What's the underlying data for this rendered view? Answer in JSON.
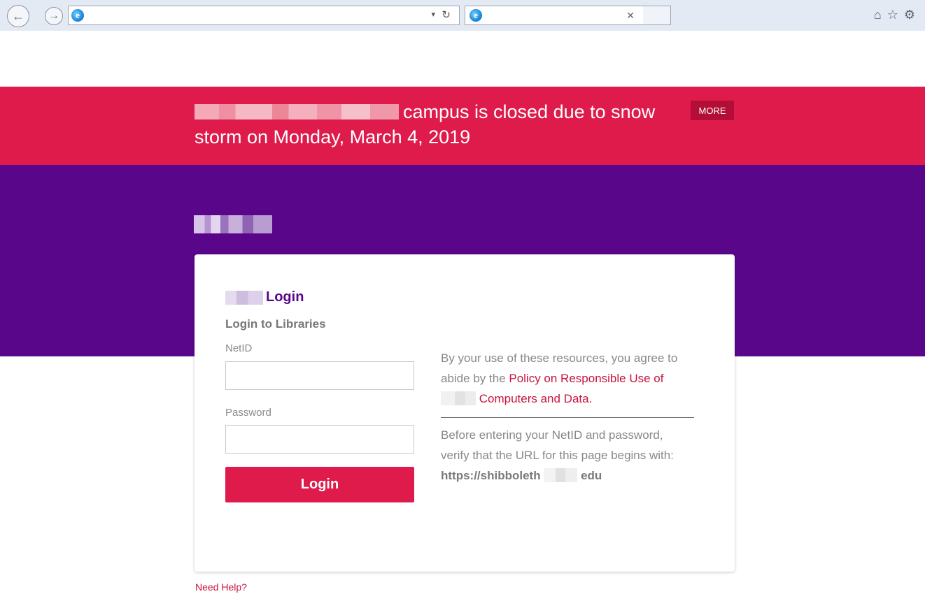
{
  "browser": {
    "address_value": "",
    "tab_title": "",
    "icons": [
      "back-icon",
      "forward-icon",
      "ie-icon",
      "dropdown-icon",
      "refresh-icon",
      "close-icon",
      "home-icon",
      "star-icon",
      "gear-icon"
    ]
  },
  "alert": {
    "text": "campus is closed due to snow storm on Monday, March 4, 2019",
    "more_label": "MORE"
  },
  "login": {
    "title": "Login",
    "subtitle": "Login to Libraries",
    "netid_label": "NetID",
    "netid_value": "",
    "password_label": "Password",
    "password_value": "",
    "button_label": "Login"
  },
  "policy": {
    "intro": "By your use of these resources, you agree to abide by the ",
    "link_part1": "Policy on Responsible Use of",
    "link_part2": "Computers and Data",
    "end": "."
  },
  "verify": {
    "text": "Before entering your NetID and password, verify that the URL for this page begins with:",
    "url_start": "https://shibboleth",
    "url_end": "edu"
  },
  "footer": {
    "help_label": "Need Help?"
  },
  "colors": {
    "alert_red": "#de1b4b",
    "more_button": "#b30e36",
    "hero_purple": "#5a068b",
    "link_red": "#c8143f"
  }
}
